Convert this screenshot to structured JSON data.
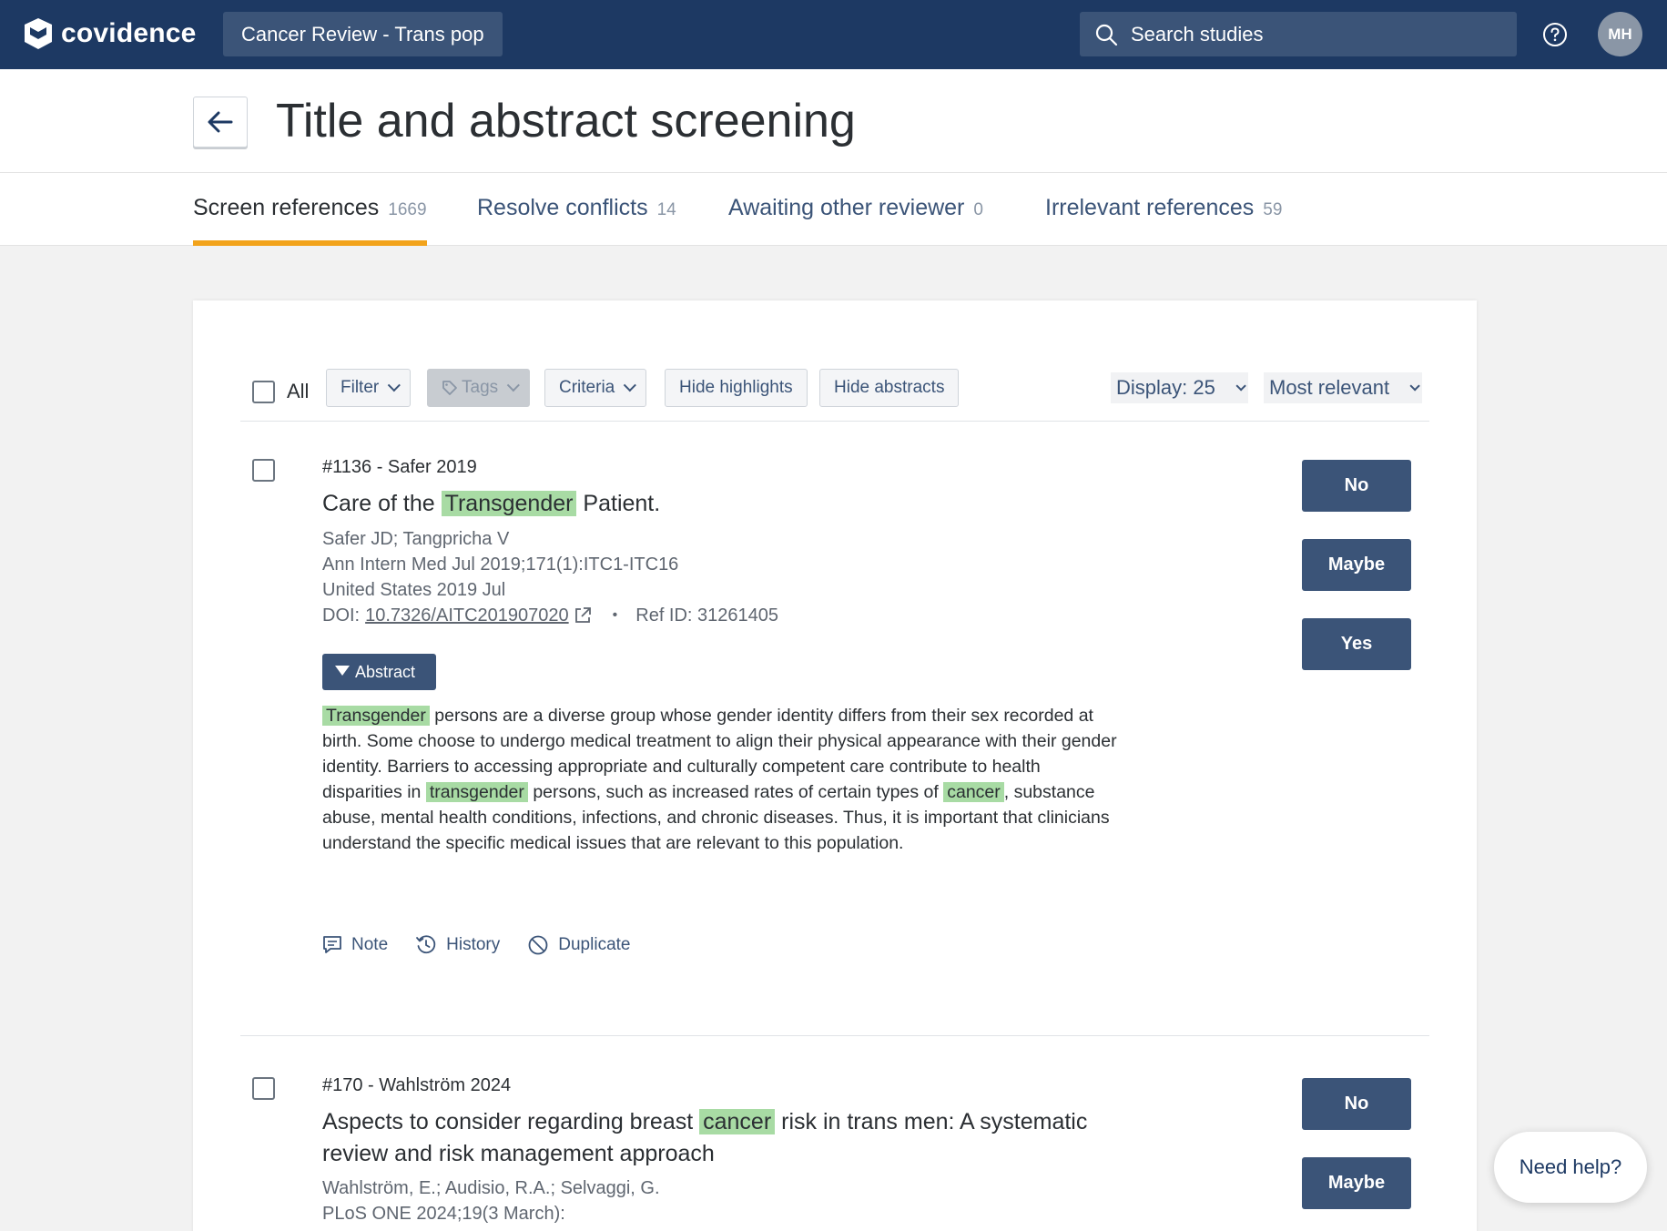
{
  "topbar": {
    "logo_text": "covidence",
    "review_name": "Cancer Review - Trans pop",
    "search_placeholder": "Search studies",
    "avatar_initials": "MH"
  },
  "header": {
    "title": "Title and abstract screening"
  },
  "tabs": [
    {
      "label": "Screen references",
      "count": "1669",
      "active": true
    },
    {
      "label": "Resolve conflicts",
      "count": "14",
      "active": false
    },
    {
      "label": "Awaiting other reviewer",
      "count": "0",
      "active": false
    },
    {
      "label": "Irrelevant references",
      "count": "59",
      "active": false
    }
  ],
  "toolbar": {
    "all_label": "All",
    "filter_label": "Filter",
    "tags_label": "Tags",
    "criteria_label": "Criteria",
    "hide_highlights_label": "Hide highlights",
    "hide_abstracts_label": "Hide abstracts",
    "display_label": "Display: 25",
    "sort_label": "Most relevant"
  },
  "references": [
    {
      "number": "#1136 - Safer 2019",
      "title_pre": "Care of the",
      "title_hl": "Transgender",
      "title_post": "Patient.",
      "authors": "Safer JD; Tangpricha V",
      "journal": "Ann Intern Med Jul 2019;171(1):ITC1-ITC16",
      "country": "United States 2019 Jul",
      "doi_label": "DOI:",
      "doi": "10.7326/AITC201907020",
      "ref_id": "Ref ID: 31261405",
      "abstract_label": "Abstract",
      "abstract_parts": {
        "hl1": "Transgender",
        "t1": "persons are a diverse group whose gender identity differs from their sex recorded at birth. Some choose to undergo medical treatment to align their physical appearance with their gender identity. Barriers to accessing appropriate and culturally competent care contribute to health disparities in",
        "hl2": "transgender",
        "t2": "persons, such as increased rates of certain types of",
        "hl3": "cancer",
        "t3": ", substance abuse, mental health conditions, infections, and chronic diseases. Thus, it is important that clinicians understand the specific medical issues that are relevant to this population."
      },
      "actions": {
        "note": "Note",
        "history": "History",
        "duplicate": "Duplicate"
      },
      "votes": {
        "no": "No",
        "maybe": "Maybe",
        "yes": "Yes"
      }
    },
    {
      "number": "#170 - Wahlström 2024",
      "title_pre": "Aspects to consider regarding breast",
      "title_hl": "cancer",
      "title_post": "risk in trans men: A systematic review and risk management approach",
      "authors": "Wahlström, E.; Audisio, R.A.; Selvaggi, G.",
      "journal": "PLoS ONE 2024;19(3 March):",
      "votes": {
        "no": "No",
        "maybe": "Maybe"
      }
    }
  ],
  "need_help": "Need help?",
  "colors": {
    "navbar": "#1d3963",
    "accent_tab": "#f2a31b",
    "button": "#3b5478",
    "highlight": "#a8dba4"
  }
}
